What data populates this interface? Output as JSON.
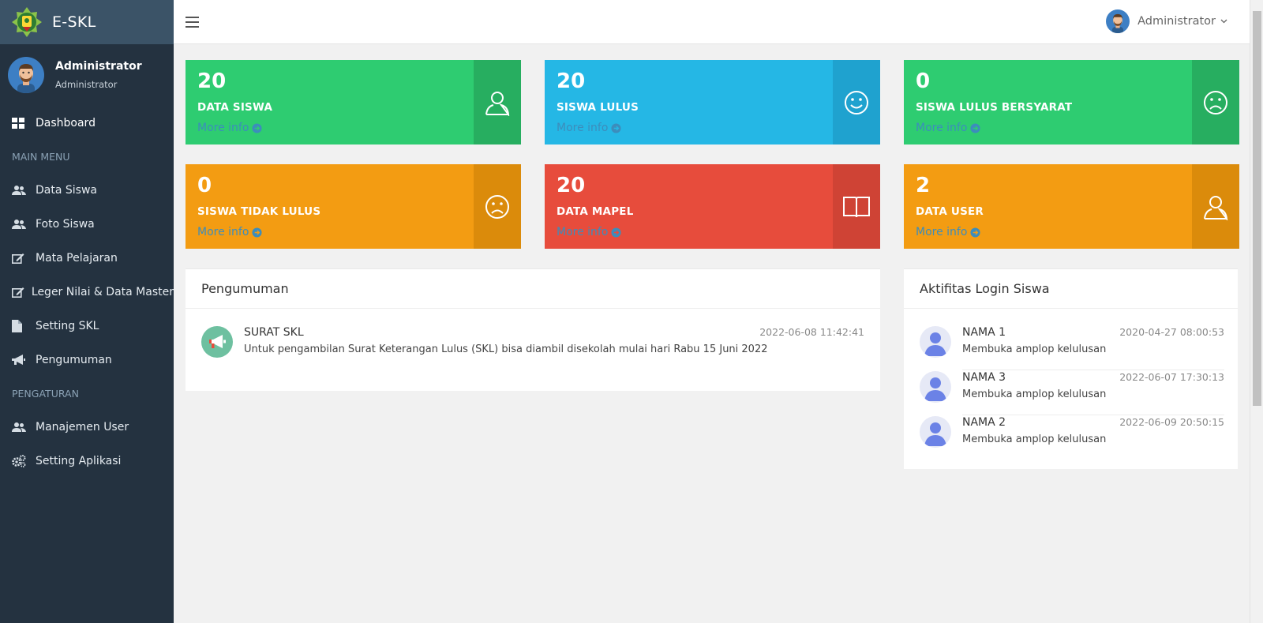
{
  "app": {
    "title": "E-SKL"
  },
  "user": {
    "name": "Administrator",
    "role": "Administrator"
  },
  "sidebar": {
    "dashboard": "Dashboard",
    "main_menu_header": "MAIN MENU",
    "main_items": [
      {
        "label": "Data Siswa",
        "icon": "users-icon"
      },
      {
        "label": "Foto Siswa",
        "icon": "users-icon"
      },
      {
        "label": "Mata Pelajaran",
        "icon": "edit-icon"
      },
      {
        "label": "Leger Nilai & Data Master",
        "icon": "edit-icon"
      },
      {
        "label": "Setting SKL",
        "icon": "file-icon"
      },
      {
        "label": "Pengumuman",
        "icon": "bullhorn-icon"
      }
    ],
    "settings_header": "PENGATURAN",
    "settings_items": [
      {
        "label": "Manajemen User",
        "icon": "users-icon"
      },
      {
        "label": "Setting Aplikasi",
        "icon": "gears-icon"
      }
    ]
  },
  "topbar": {
    "user_name": "Administrator"
  },
  "stats": [
    {
      "value": "20",
      "label": "DATA SISWA",
      "more": "More info",
      "color": "#2ecc71",
      "icon_bg": "#27ae60",
      "icon": "user-outline-icon"
    },
    {
      "value": "20",
      "label": "SISWA LULUS",
      "more": "More info",
      "color": "#25b7e5",
      "icon_bg": "#1fa2cf",
      "icon": "smile-icon"
    },
    {
      "value": "0",
      "label": "SISWA LULUS BERSYARAT",
      "more": "More info",
      "color": "#2ecc71",
      "icon_bg": "#27ae60",
      "icon": "frown-icon"
    },
    {
      "value": "0",
      "label": "SISWA TIDAK LULUS",
      "more": "More info",
      "color": "#f39c12",
      "icon_bg": "#db8b0b",
      "icon": "frown-icon"
    },
    {
      "value": "20",
      "label": "DATA MAPEL",
      "more": "More info",
      "color": "#e74c3c",
      "icon_bg": "#cf4335",
      "icon": "book-icon"
    },
    {
      "value": "2",
      "label": "DATA USER",
      "more": "More info",
      "color": "#f39c12",
      "icon_bg": "#db8b0b",
      "icon": "user-outline-icon"
    }
  ],
  "announcements": {
    "title": "Pengumuman",
    "items": [
      {
        "title": "SURAT SKL",
        "date": "2022-06-08 11:42:41",
        "text": "Untuk pengambilan Surat Keterangan Lulus (SKL) bisa diambil disekolah mulai hari Rabu 15 Juni 2022"
      }
    ]
  },
  "login_activity": {
    "title": "Aktifitas Login Siswa",
    "items": [
      {
        "name": "NAMA 1",
        "date": "2020-04-27 08:00:53",
        "text": "Membuka amplop kelulusan"
      },
      {
        "name": "NAMA 3",
        "date": "2022-06-07 17:30:13",
        "text": "Membuka amplop kelulusan"
      },
      {
        "name": "NAMA 2",
        "date": "2022-06-09 20:50:15",
        "text": "Membuka amplop kelulusan"
      }
    ]
  }
}
